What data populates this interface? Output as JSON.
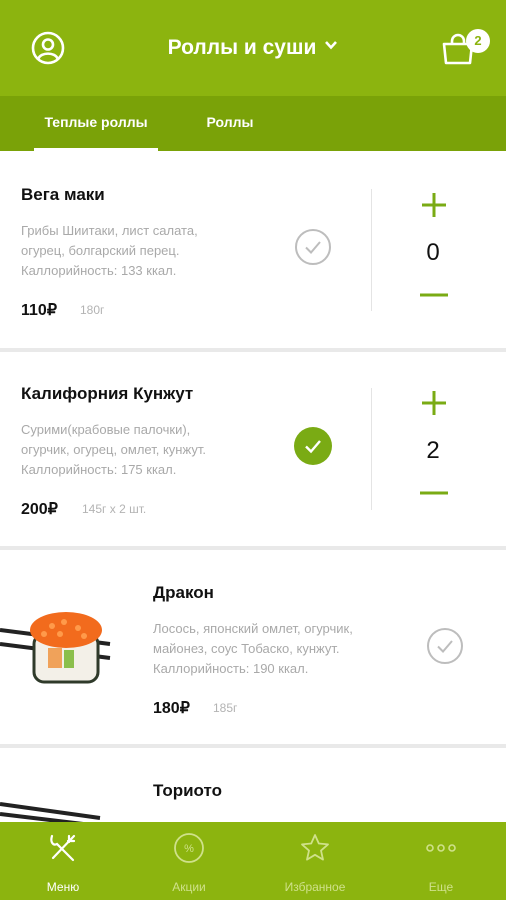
{
  "header": {
    "title": "Роллы и суши",
    "cart_count": "2"
  },
  "tabs": [
    {
      "label": "Теплые роллы",
      "active": true
    },
    {
      "label": "Роллы",
      "active": false
    }
  ],
  "products": [
    {
      "name": "Вега маки",
      "desc1": "Грибы Шиитаки, лист салата,",
      "desc2": "огурец, болгарский перец.",
      "calories": "Каллорийность: 133 ккал.",
      "price": "110₽",
      "weight": "180г",
      "qty": "0",
      "selected": false
    },
    {
      "name": "Калифорния Кунжут",
      "desc1": "Сурими(крабовые палочки),",
      "desc2": "огурчик, огурец, омлет, кунжут.",
      "calories": "Каллорийность: 175 ккал.",
      "price": "200₽",
      "weight": "145г х 2 шт.",
      "qty": "2",
      "selected": true
    },
    {
      "name": "Дракон",
      "desc1": "Лосось, японский омлет, огурчик,",
      "desc2": "майонез, соус Тобаско, кунжут.",
      "calories": "Каллорийность: 190 ккал.",
      "price": "180₽",
      "weight": "185г",
      "selected": false
    },
    {
      "name": "Ториото"
    }
  ],
  "tabbar": [
    {
      "label": "Меню",
      "icon": "fork-knife-icon",
      "active": true
    },
    {
      "label": "Акции",
      "icon": "percent-icon",
      "active": false
    },
    {
      "label": "Избранное",
      "icon": "star-icon",
      "active": false
    },
    {
      "label": "Еще",
      "icon": "more-icon",
      "active": false
    }
  ],
  "colors": {
    "brand_green": "#8cb40f",
    "tab_green": "#7aa208"
  }
}
